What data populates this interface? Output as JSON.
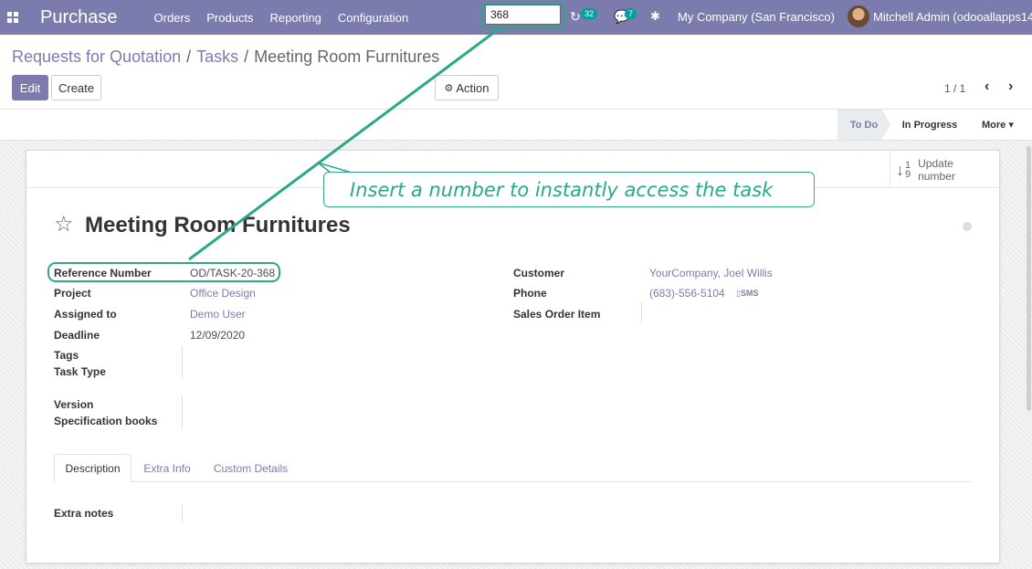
{
  "navbar": {
    "app_title": "Purchase",
    "menu": [
      "Orders",
      "Products",
      "Reporting",
      "Configuration"
    ],
    "search_value": "368",
    "activity_count": "32",
    "message_count": "7",
    "company": "My Company (San Francisco)",
    "user": "Mitchell Admin (odooallapps14)"
  },
  "breadcrumb": {
    "items": [
      "Requests for Quotation",
      "Tasks"
    ],
    "current": "Meeting Room Furnitures"
  },
  "buttons": {
    "edit": "Edit",
    "create": "Create",
    "action": "Action"
  },
  "pager": {
    "value": "1 / 1",
    "prev": "‹",
    "next": "›"
  },
  "stages": {
    "active": "To Do",
    "next": "In Progress",
    "more": "More ▾"
  },
  "stat_button": {
    "top_digit": "1",
    "bottom_digit": "9",
    "label_line1": "Update",
    "label_line2": "number"
  },
  "record": {
    "title": "Meeting Room Furnitures",
    "left_fields": [
      {
        "label": "Reference Number",
        "value": "OD/TASK-20-368"
      },
      {
        "label": "Project",
        "value": "Office Design"
      },
      {
        "label": "Assigned to",
        "value": "Demo User"
      },
      {
        "label": "Deadline",
        "value": "12/09/2020"
      },
      {
        "label": "Tags",
        "value": ""
      },
      {
        "label": "Task Type",
        "value": ""
      },
      {
        "label": "Version",
        "value": ""
      },
      {
        "label": "Specification books",
        "value": ""
      }
    ],
    "right_fields": [
      {
        "label": "Customer",
        "value": "YourCompany, Joel Willis"
      },
      {
        "label": "Phone",
        "value": "(683)-556-5104"
      },
      {
        "label": "Sales Order Item",
        "value": ""
      }
    ],
    "sms_label": "SMS"
  },
  "tabs": [
    "Description",
    "Extra Info",
    "Custom Details"
  ],
  "extra_notes_label": "Extra notes",
  "callout_text": "Insert a number to instantly access the task",
  "colors": {
    "brand": "#7c7bad",
    "accent": "#2aa889",
    "badge": "#00a09d"
  }
}
